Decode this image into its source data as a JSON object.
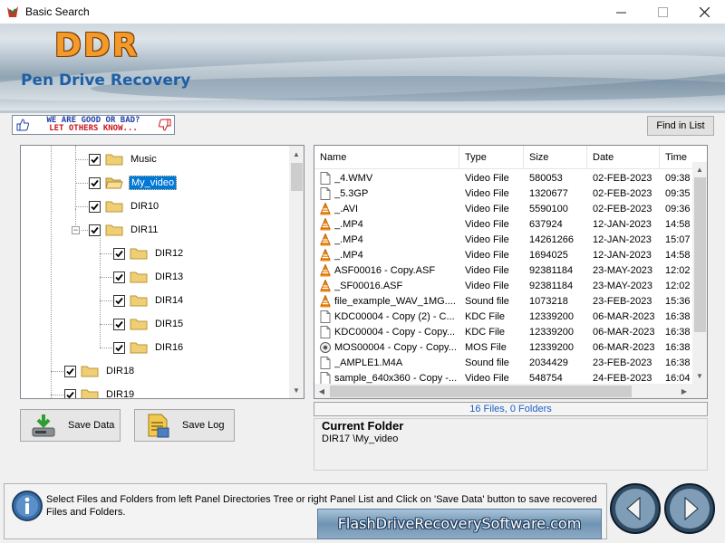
{
  "window": {
    "title": "Basic Search"
  },
  "banner": {
    "brand": "DDR",
    "product": "Pen Drive Recovery"
  },
  "feedback": {
    "line1": "WE ARE GOOD OR BAD?",
    "line2": "LET OTHERS KNOW..."
  },
  "toolbar": {
    "find_label": "Find in List"
  },
  "tree": {
    "items": [
      {
        "label": "Music",
        "checked": true,
        "selected": false
      },
      {
        "label": "My_video",
        "checked": true,
        "selected": true
      },
      {
        "label": "DIR10",
        "checked": true,
        "selected": false
      },
      {
        "label": "DIR11",
        "checked": true,
        "selected": false,
        "expanded": true
      },
      {
        "label": "DIR12",
        "checked": true,
        "selected": false
      },
      {
        "label": "DIR13",
        "checked": true,
        "selected": false
      },
      {
        "label": "DIR14",
        "checked": true,
        "selected": false
      },
      {
        "label": "DIR15",
        "checked": true,
        "selected": false
      },
      {
        "label": "DIR16",
        "checked": true,
        "selected": false
      },
      {
        "label": "DIR18",
        "checked": true,
        "selected": false
      },
      {
        "label": "DIR19",
        "checked": true,
        "selected": false
      }
    ]
  },
  "list": {
    "columns": [
      "Name",
      "Type",
      "Size",
      "Date",
      "Time"
    ],
    "rows": [
      {
        "icon": "doc-icon",
        "name": "_4.WMV",
        "type": "Video File",
        "size": "580053",
        "date": "02-FEB-2023",
        "time": "09:38"
      },
      {
        "icon": "doc-icon",
        "name": "_5.3GP",
        "type": "Video File",
        "size": "1320677",
        "date": "02-FEB-2023",
        "time": "09:35"
      },
      {
        "icon": "vlc-icon",
        "name": "_.AVI",
        "type": "Video File",
        "size": "5590100",
        "date": "02-FEB-2023",
        "time": "09:36"
      },
      {
        "icon": "vlc-icon",
        "name": "_.MP4",
        "type": "Video File",
        "size": "637924",
        "date": "12-JAN-2023",
        "time": "14:58"
      },
      {
        "icon": "vlc-icon",
        "name": "_.MP4",
        "type": "Video File",
        "size": "14261266",
        "date": "12-JAN-2023",
        "time": "15:07"
      },
      {
        "icon": "vlc-icon",
        "name": "_.MP4",
        "type": "Video File",
        "size": "1694025",
        "date": "12-JAN-2023",
        "time": "14:58"
      },
      {
        "icon": "vlc-icon",
        "name": "ASF00016 - Copy.ASF",
        "type": "Video File",
        "size": "92381184",
        "date": "23-MAY-2023",
        "time": "12:02"
      },
      {
        "icon": "vlc-icon",
        "name": "_SF00016.ASF",
        "type": "Video File",
        "size": "92381184",
        "date": "23-MAY-2023",
        "time": "12:02"
      },
      {
        "icon": "vlc-icon",
        "name": "file_example_WAV_1MG....",
        "type": "Sound file",
        "size": "1073218",
        "date": "23-FEB-2023",
        "time": "15:36"
      },
      {
        "icon": "doc-icon",
        "name": "KDC00004 - Copy (2) - C...",
        "type": "KDC File",
        "size": "12339200",
        "date": "06-MAR-2023",
        "time": "16:38"
      },
      {
        "icon": "doc-icon",
        "name": "KDC00004 - Copy - Copy...",
        "type": "KDC File",
        "size": "12339200",
        "date": "06-MAR-2023",
        "time": "16:38"
      },
      {
        "icon": "mos-icon",
        "name": "MOS00004 - Copy - Copy...",
        "type": "MOS File",
        "size": "12339200",
        "date": "06-MAR-2023",
        "time": "16:38"
      },
      {
        "icon": "doc-icon",
        "name": "_AMPLE1.M4A",
        "type": "Sound file",
        "size": "2034429",
        "date": "23-FEB-2023",
        "time": "16:38"
      },
      {
        "icon": "doc-icon",
        "name": "sample_640x360 - Copy -...",
        "type": "Video File",
        "size": "548754",
        "date": "24-FEB-2023",
        "time": "16:04"
      }
    ]
  },
  "status": {
    "summary": "16 Files, 0 Folders"
  },
  "current_folder": {
    "title": "Current Folder",
    "path": "DIR17 \\My_video"
  },
  "buttons": {
    "save_data": "Save Data",
    "save_log": "Save Log"
  },
  "info": {
    "text": "Select Files and Folders from left Panel Directories Tree or right Panel List and Click on 'Save Data' button to save recovered Files and Folders."
  },
  "footer": {
    "site": "FlashDriveRecoverySoftware.com"
  }
}
